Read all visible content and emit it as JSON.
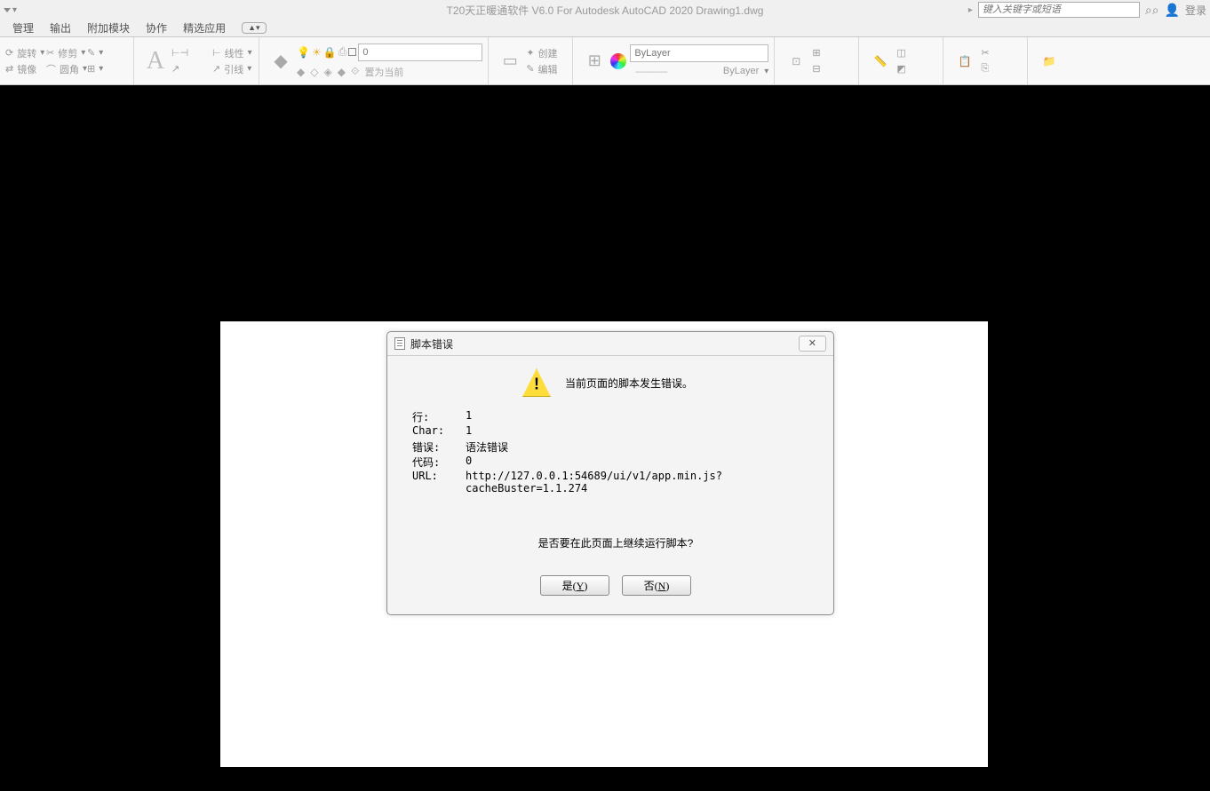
{
  "titlebar": {
    "app_title": "T20天正暖通软件 V6.0 For Autodesk AutoCAD 2020    Drawing1.dwg",
    "search_placeholder": "键入关键字或短语",
    "login_label": "登录"
  },
  "menubar": {
    "items": [
      "管理",
      "输出",
      "附加模块",
      "协作",
      "精选应用"
    ]
  },
  "ribbon": {
    "rotate": "旋转",
    "mirror": "镜像",
    "trim": "修剪",
    "fillet": "圆角",
    "linetype": "线性",
    "leader": "引线",
    "setcurrent": "置为当前",
    "create": "创建",
    "edit": "编辑",
    "layer0": "0",
    "bylayer": "ByLayer",
    "bylayer2": "ByLayer"
  },
  "dialog": {
    "title": "脚本错误",
    "message": "当前页面的脚本发生错误。",
    "k_line": "行:",
    "k_char": "Char:",
    "k_err": "错误:",
    "k_code": "代码:",
    "k_url": "URL:",
    "v_line": "1",
    "v_char": "1",
    "v_err": "语法错误",
    "v_code": "0",
    "v_url_a": "http://127.0.0.1:54689/ui/v1/app.min.js?",
    "v_url_b": "cacheBuster=1.1.274",
    "question": "是否要在此页面上继续运行脚本?",
    "yes": "是(Y)",
    "no": "否(N)"
  }
}
